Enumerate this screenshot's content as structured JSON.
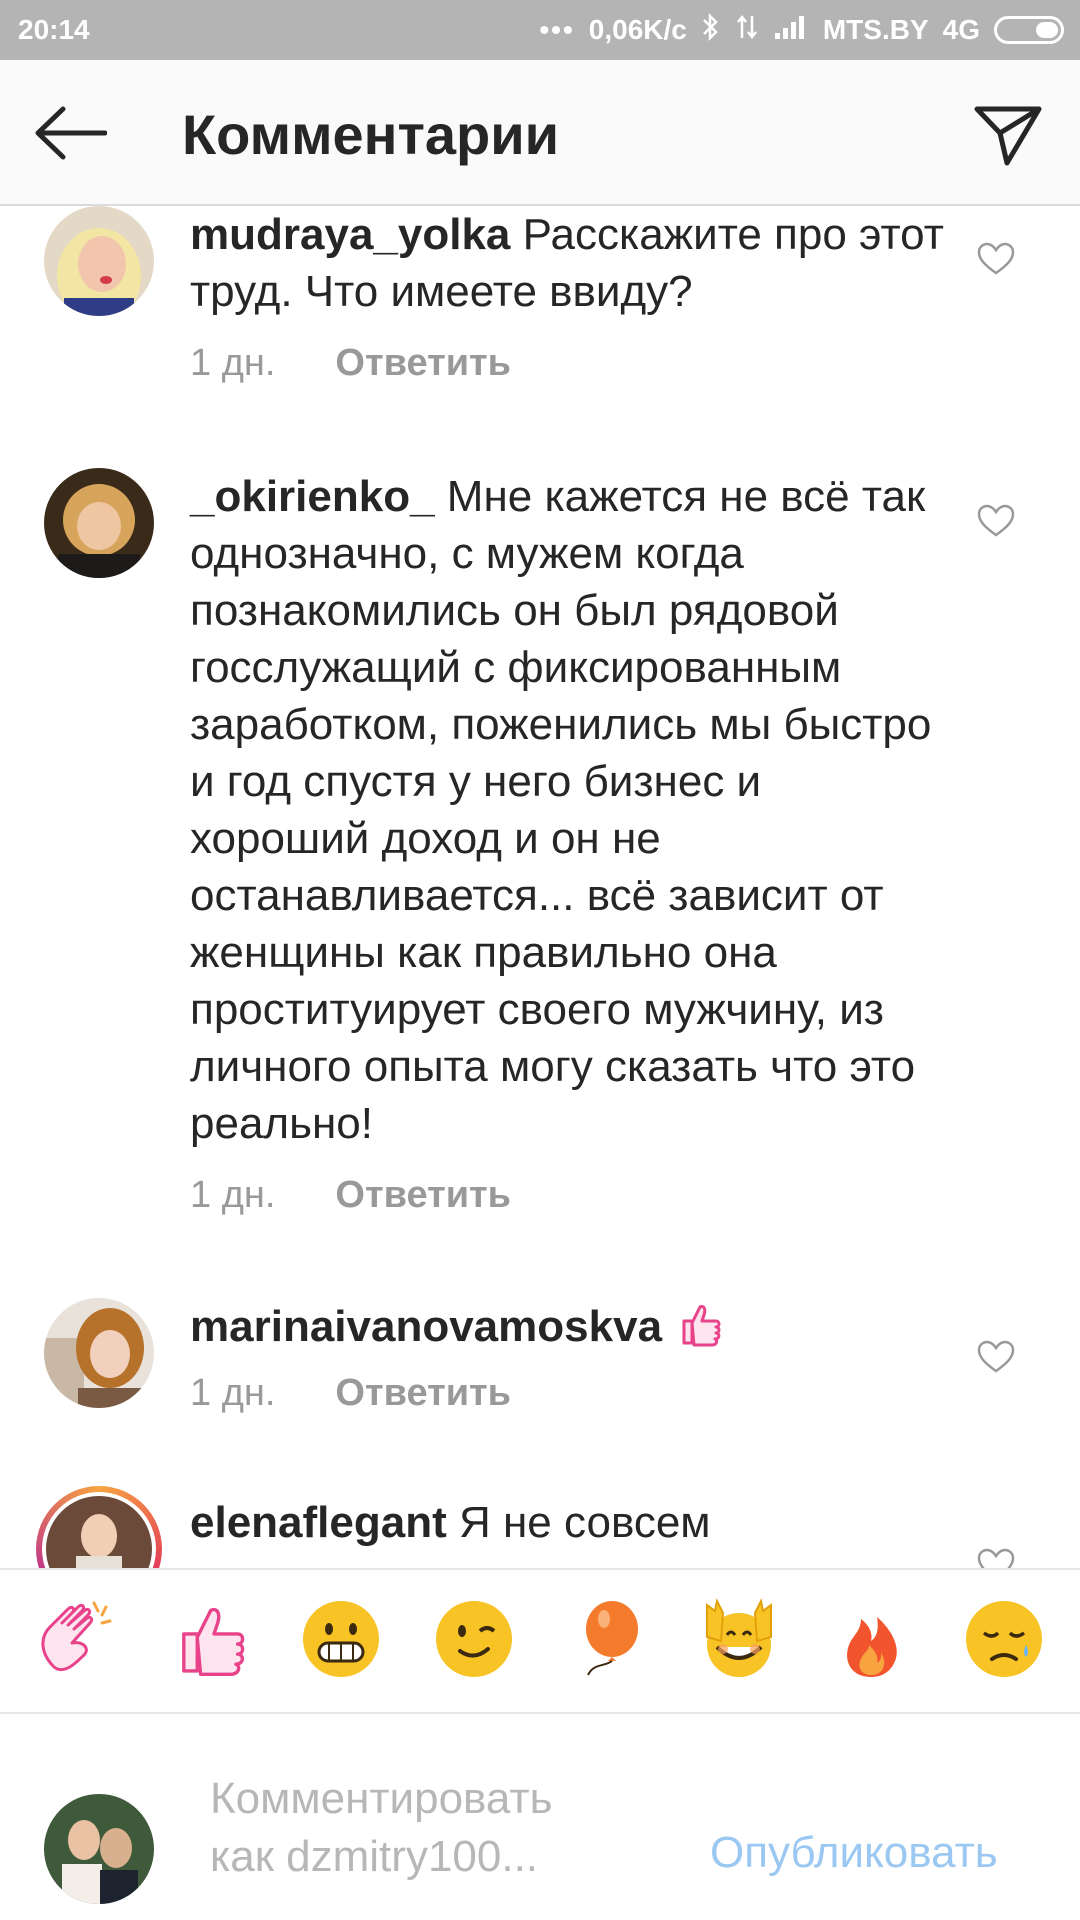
{
  "status_bar": {
    "time": "20:14",
    "dots": "•••",
    "network_speed": "0,06K/c",
    "carrier": "MTS.BY",
    "network_type": "4G"
  },
  "header": {
    "title": "Комментарии"
  },
  "comments": [
    {
      "username": "mudraya_yolka",
      "text": "Расскажите про этот труд. Что имеете ввиду?",
      "time": "1 дн.",
      "reply_label": "Ответить"
    },
    {
      "username": "_okirienko_",
      "text": "Мне кажется не всё так однозначно, с мужем когда познакомились он был рядовой госслужащий с фиксированным заработком, поженились мы быстро и год спустя у него бизнес и хороший доход и он не останавливается... всё зависит от женщины как правильно она проституирует своего мужчину, из личного опыта могу сказать что это реально!",
      "time": "1 дн.",
      "reply_label": "Ответить"
    },
    {
      "username": "marinaivanovamoskva",
      "text": "",
      "time": "1 дн.",
      "reply_label": "Ответить"
    },
    {
      "username": "elenaflegant",
      "text": "Я не совсем",
      "time": "",
      "reply_label": ""
    }
  ],
  "emoji_bar": [
    "clapping-hands",
    "thumbs-up",
    "grinning-face",
    "winking-face",
    "balloon",
    "raising-hands-face",
    "fire",
    "sad-face"
  ],
  "composer": {
    "placeholder_line1": "Комментировать",
    "placeholder_line2": "как dzmitry100...",
    "publish_label": "Опубликовать"
  },
  "colors": {
    "status_bar": "#b4b4b4",
    "header_bg": "#fafafa",
    "meta_text": "#999999",
    "publish": "#9bc8f2",
    "emoji_pink": "#e8428a",
    "emoji_yellow": "#f7c325"
  }
}
